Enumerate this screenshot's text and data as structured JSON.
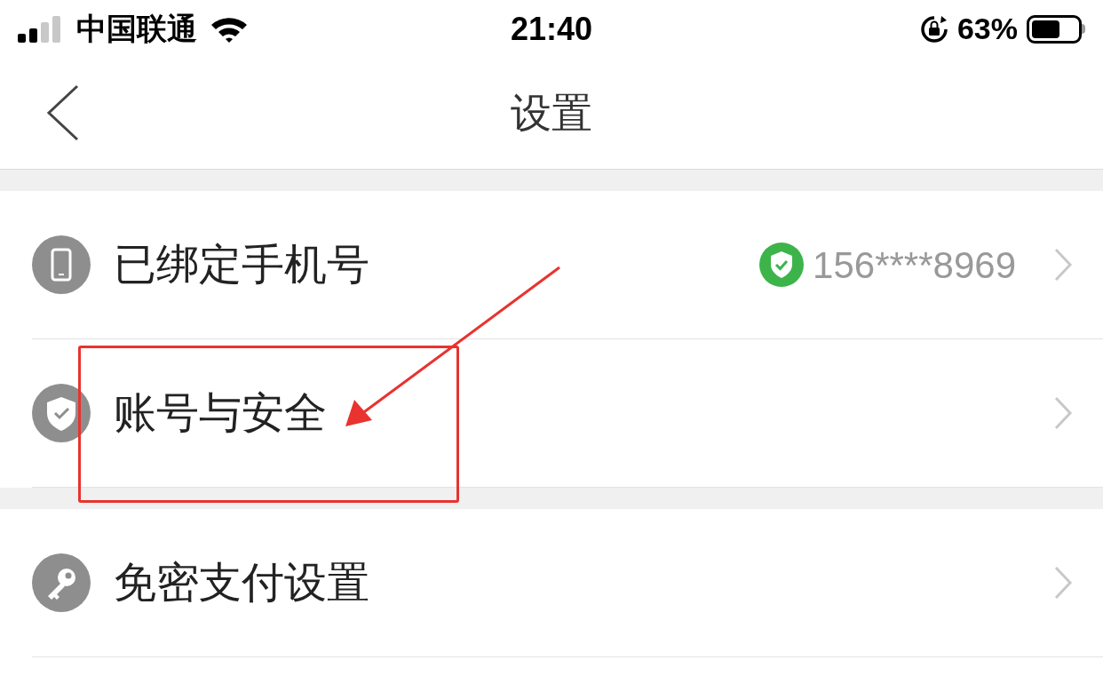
{
  "status_bar": {
    "carrier": "中国联通",
    "time": "21:40",
    "battery": "63%"
  },
  "header": {
    "title": "设置"
  },
  "groups": [
    {
      "rows": [
        {
          "label": "已绑定手机号",
          "value": "156****8969",
          "verified": true
        },
        {
          "label": "账号与安全",
          "verified": false
        }
      ]
    },
    {
      "rows": [
        {
          "label": "免密支付设置",
          "verified": false
        }
      ]
    }
  ]
}
